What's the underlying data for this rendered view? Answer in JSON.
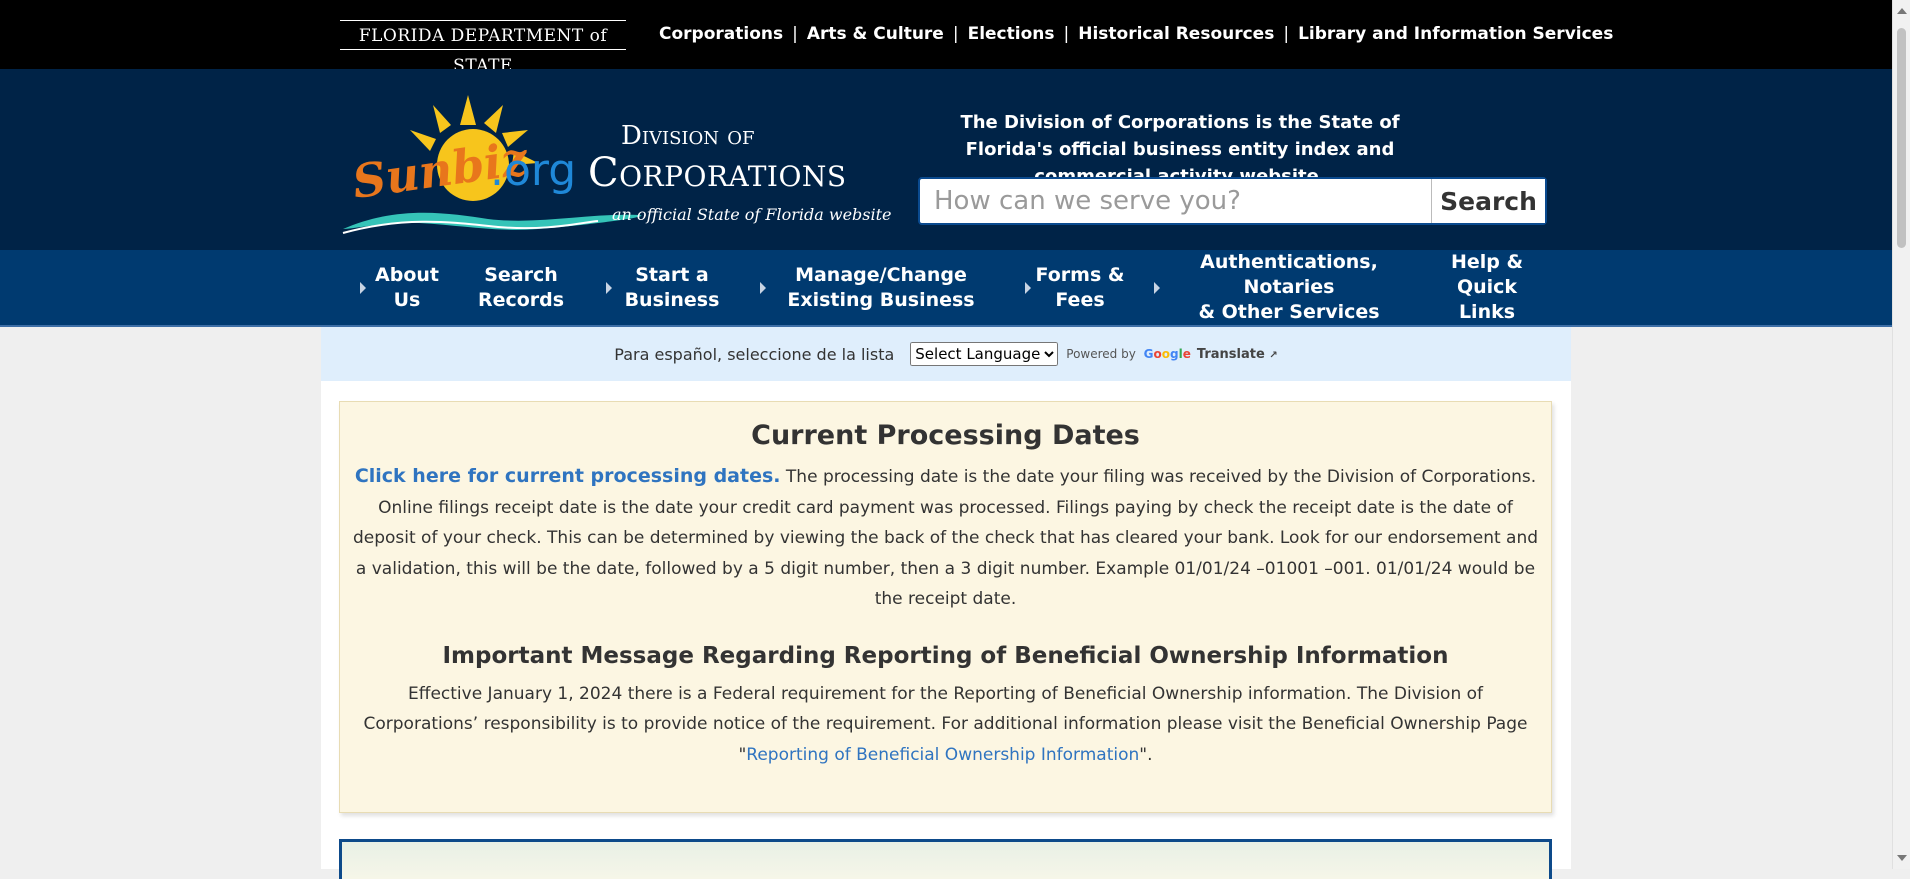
{
  "topbar": {
    "dos_logo": "FLORIDA DEPARTMENT of STATE",
    "links": [
      "Corporations",
      "Arts & Culture",
      "Elections",
      "Historical Resources",
      "Library and Information Services"
    ],
    "separator": "|"
  },
  "header": {
    "logo_sunbiz": "Sunbiz",
    "logo_org": ".org",
    "logo_division": "Division of",
    "logo_corporations": "Corporations",
    "logo_official": "an official State of Florida website",
    "tagline": "The Division of Corporations is the State of Florida's official business entity index and commercial activity website.",
    "search_placeholder": "How can we serve you?",
    "search_button": "Search"
  },
  "mainnav": {
    "items": [
      {
        "label_1": "About",
        "label_2": "Us"
      },
      {
        "label_1": "Search",
        "label_2": "Records"
      },
      {
        "label_1": "Start a",
        "label_2": "Business"
      },
      {
        "label_1": "Manage/Change",
        "label_2": "Existing Business"
      },
      {
        "label_1": "Forms &",
        "label_2": "Fees"
      },
      {
        "label_1": "Authentications, Notaries",
        "label_2": "& Other Services"
      },
      {
        "label_1": "Help &",
        "label_2": "Quick",
        "label_3": "Links"
      }
    ]
  },
  "translate": {
    "prompt": "Para español, seleccione de la lista",
    "select_value": "Select Language",
    "powered_by": "Powered by",
    "translate_label": "Translate"
  },
  "notice": {
    "title": "Current Processing Dates",
    "link_text": "Click here for current processing dates.",
    "body1": " The processing date is the date your filing was received by the Division of Corporations. Online filings receipt date is the date your credit card payment was processed. Filings paying by check the receipt date is the date of deposit of your check.  This can be determined by viewing the back of the check that has cleared your bank.  Look for our endorsement and a validation, this will be the date, followed by a 5 digit  number, then a 3 digit number. Example 01/01/24 –01001 –001. 01/01/24 would be the receipt date.",
    "subtitle": "Important Message Regarding Reporting of Beneficial Ownership Information",
    "body2": "Effective January 1, 2024 there is a Federal requirement for the Reporting of Beneficial Ownership information. The Division of Corporations’ responsibility is to provide notice of the requirement.  For additional information please visit the Beneficial Ownership Page \"",
    "bo_link": "Reporting of Beneficial Ownership Information",
    "body2_end": "\"."
  },
  "colors": {
    "topbar": "#000000",
    "header": "#002347",
    "nav": "#003a70",
    "notice_bg": "#fcf6e2",
    "link": "#2f74c0"
  }
}
